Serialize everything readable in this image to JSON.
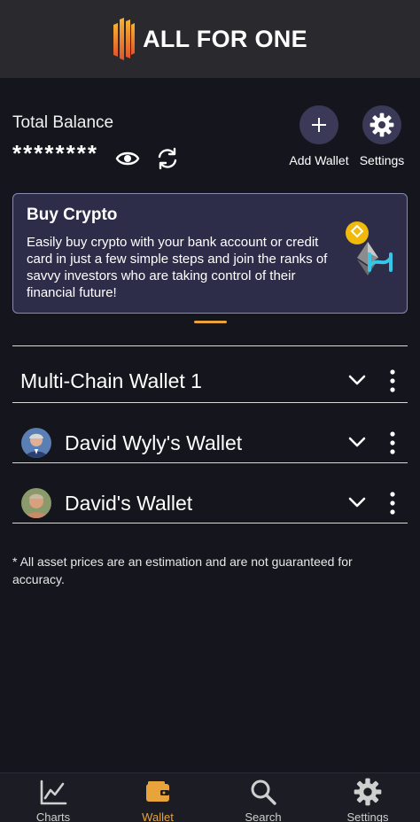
{
  "app": {
    "title": "ALL FOR ONE"
  },
  "balance": {
    "label": "Total Balance",
    "value": "********"
  },
  "actions": {
    "add_wallet": "Add Wallet",
    "settings": "Settings"
  },
  "promo": {
    "title": "Buy Crypto",
    "text": "Easily buy crypto with your bank account or credit card in just a few simple steps and join the ranks of savvy investors who are taking control of their financial future!"
  },
  "wallets": [
    {
      "name": "Multi-Chain Wallet 1",
      "has_avatar": false
    },
    {
      "name": "David Wyly's Wallet",
      "has_avatar": true
    },
    {
      "name": "David's Wallet",
      "has_avatar": true
    }
  ],
  "disclaimer": "* All asset prices are an estimation and are not guaranteed for accuracy.",
  "nav": {
    "tabs": [
      {
        "label": "Charts",
        "icon": "chart-icon",
        "active": false
      },
      {
        "label": "Wallet",
        "icon": "wallet-icon",
        "active": true
      },
      {
        "label": "Search",
        "icon": "search-icon",
        "active": false
      },
      {
        "label": "Settings",
        "icon": "gear-icon",
        "active": false
      }
    ]
  },
  "colors": {
    "background": "#15151e",
    "topbar": "#2a2a2e",
    "accent": "#e8a33a",
    "promo_bg": "#2d2d4a",
    "action_circle": "#3a3a58"
  }
}
